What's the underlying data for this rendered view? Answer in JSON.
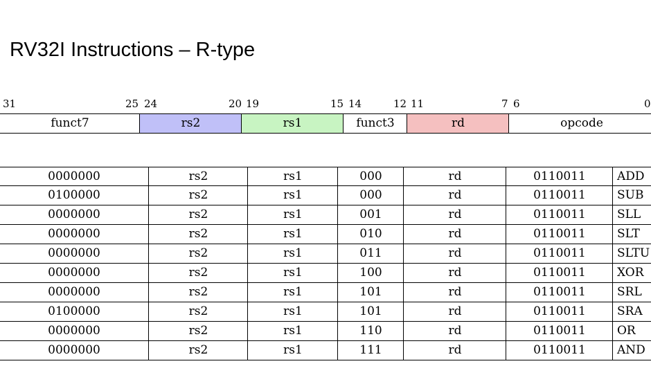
{
  "title": "RV32I Instructions – R-type",
  "bit_labels": [
    "31",
    "25",
    "24",
    "20",
    "19",
    "15",
    "14",
    "12",
    "11",
    "7",
    "6",
    "0"
  ],
  "format_fields": [
    {
      "label": "funct7",
      "color": "#ffffff"
    },
    {
      "label": "rs2",
      "color": "#c0c0f8"
    },
    {
      "label": "rs1",
      "color": "#c8f4c2"
    },
    {
      "label": "funct3",
      "color": "#ffffff"
    },
    {
      "label": "rd",
      "color": "#f5c0c0"
    },
    {
      "label": "opcode",
      "color": "#ffffff"
    }
  ],
  "instructions": [
    {
      "funct7": "0000000",
      "rs2": "rs2",
      "rs1": "rs1",
      "funct3": "000",
      "rd": "rd",
      "opcode": "0110011",
      "name": "ADD"
    },
    {
      "funct7": "0100000",
      "rs2": "rs2",
      "rs1": "rs1",
      "funct3": "000",
      "rd": "rd",
      "opcode": "0110011",
      "name": "SUB"
    },
    {
      "funct7": "0000000",
      "rs2": "rs2",
      "rs1": "rs1",
      "funct3": "001",
      "rd": "rd",
      "opcode": "0110011",
      "name": "SLL"
    },
    {
      "funct7": "0000000",
      "rs2": "rs2",
      "rs1": "rs1",
      "funct3": "010",
      "rd": "rd",
      "opcode": "0110011",
      "name": "SLT"
    },
    {
      "funct7": "0000000",
      "rs2": "rs2",
      "rs1": "rs1",
      "funct3": "011",
      "rd": "rd",
      "opcode": "0110011",
      "name": "SLTU"
    },
    {
      "funct7": "0000000",
      "rs2": "rs2",
      "rs1": "rs1",
      "funct3": "100",
      "rd": "rd",
      "opcode": "0110011",
      "name": "XOR"
    },
    {
      "funct7": "0000000",
      "rs2": "rs2",
      "rs1": "rs1",
      "funct3": "101",
      "rd": "rd",
      "opcode": "0110011",
      "name": "SRL"
    },
    {
      "funct7": "0100000",
      "rs2": "rs2",
      "rs1": "rs1",
      "funct3": "101",
      "rd": "rd",
      "opcode": "0110011",
      "name": "SRA"
    },
    {
      "funct7": "0000000",
      "rs2": "rs2",
      "rs1": "rs1",
      "funct3": "110",
      "rd": "rd",
      "opcode": "0110011",
      "name": "OR"
    },
    {
      "funct7": "0000000",
      "rs2": "rs2",
      "rs1": "rs1",
      "funct3": "111",
      "rd": "rd",
      "opcode": "0110011",
      "name": "AND"
    }
  ]
}
